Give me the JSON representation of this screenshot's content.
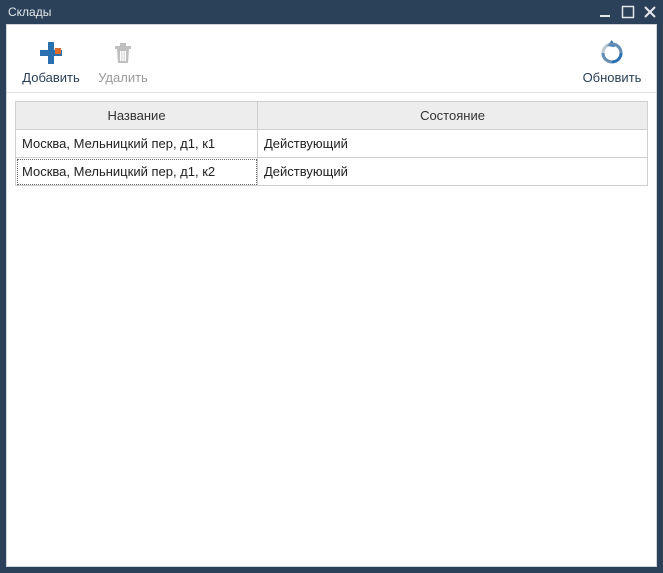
{
  "window": {
    "title": "Склады"
  },
  "toolbar": {
    "add_label": "Добавить",
    "delete_label": "Удалить",
    "refresh_label": "Обновить"
  },
  "table": {
    "headers": {
      "name": "Название",
      "status": "Состояние"
    },
    "rows": [
      {
        "name": "Москва, Мельницкий пер, д1, к1",
        "status": "Действующий"
      },
      {
        "name": "Москва, Мельницкий пер, д1, к2",
        "status": "Действующий"
      }
    ]
  }
}
